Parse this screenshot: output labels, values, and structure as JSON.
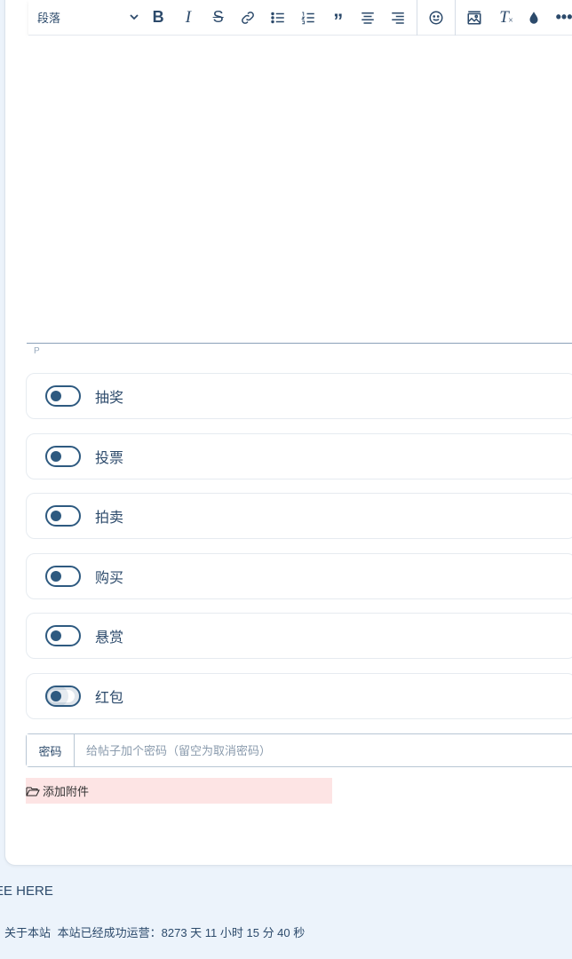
{
  "toolbar": {
    "block_format": "段落",
    "buttons": [
      {
        "name": "bold-icon",
        "glyph": "B"
      },
      {
        "name": "italic-icon",
        "glyph": "I"
      },
      {
        "name": "strikethrough-icon",
        "glyph": "S"
      },
      {
        "name": "link-icon",
        "glyph": "link"
      },
      {
        "name": "bullet-list-icon",
        "glyph": "ul"
      },
      {
        "name": "numbered-list-icon",
        "glyph": "ol"
      },
      {
        "name": "blockquote-icon",
        "glyph": "quote"
      },
      {
        "name": "align-center-icon",
        "glyph": "center"
      },
      {
        "name": "align-right-icon",
        "glyph": "right"
      },
      {
        "name": "emoji-icon",
        "glyph": "smile"
      },
      {
        "name": "image-icon",
        "glyph": "image"
      },
      {
        "name": "clear-format-icon",
        "glyph": "Tx"
      },
      {
        "name": "color-drop-icon",
        "glyph": "drop"
      },
      {
        "name": "more-icon",
        "glyph": "more"
      }
    ]
  },
  "editor": {
    "status_path": "P"
  },
  "options": [
    {
      "label": "抽奖"
    },
    {
      "label": "投票"
    },
    {
      "label": "拍卖"
    },
    {
      "label": "购买"
    },
    {
      "label": "悬赏"
    },
    {
      "label": "红包"
    }
  ],
  "password": {
    "label": "密码",
    "placeholder": "给帖子加个密码（留空为取消密码）",
    "value": ""
  },
  "attachment": {
    "label": "添加附件"
  },
  "see_here": "EE HERE",
  "footer": {
    "about": "关于本站",
    "uptime": "本站已经成功运营：8273 天 11 小时 15 分 40 秒"
  },
  "colors": {
    "accent": "#2e5a80",
    "page_bg": "#ecf3fb",
    "attach_bg": "#fde4e4"
  }
}
